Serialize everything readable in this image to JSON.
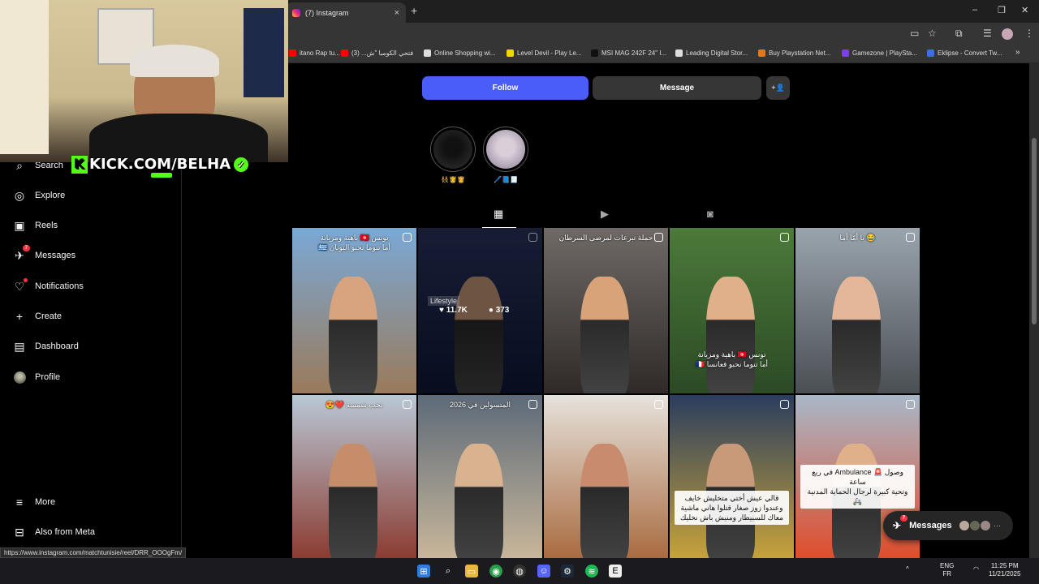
{
  "browser": {
    "tab_title": "(7) Instagram",
    "new_tab": "+",
    "tab_close": "×",
    "window_controls": [
      "–",
      "❐",
      "✕"
    ],
    "bookmarks": [
      {
        "label": "itano Rap tu...",
        "color": "#ff0000"
      },
      {
        "label": "فتحي الكومبا \"ش... (3)",
        "color": "#ff0000"
      },
      {
        "label": "Online Shopping wi...",
        "color": "#dddddd"
      },
      {
        "label": "Level Devil - Play Le...",
        "color": "#f2d600"
      },
      {
        "label": "MSI MAG 242F 24\" I...",
        "color": "#111111"
      },
      {
        "label": "Leading Digital Stor...",
        "color": "#dddddd"
      },
      {
        "label": "Buy Playstation Net...",
        "color": "#e07a1f"
      },
      {
        "label": "Gamezone | PlaySta...",
        "color": "#7b3fe4"
      },
      {
        "label": "Eklipse - Convert Tw...",
        "color": "#3a6df0"
      }
    ],
    "more_bookmarks": "»"
  },
  "sidebar": {
    "items": [
      {
        "label": "Search",
        "icon": "search-icon"
      },
      {
        "label": "Explore",
        "icon": "compass-icon"
      },
      {
        "label": "Reels",
        "icon": "reels-icon"
      },
      {
        "label": "Messages",
        "icon": "messenger-icon",
        "badge": "7"
      },
      {
        "label": "Notifications",
        "icon": "heart-icon"
      },
      {
        "label": "Create",
        "icon": "plus-icon"
      },
      {
        "label": "Dashboard",
        "icon": "dashboard-icon"
      },
      {
        "label": "Profile",
        "icon": "avatar"
      },
      {
        "label": "More",
        "icon": "menu-icon"
      },
      {
        "label": "Also from Meta",
        "icon": "meta-icon"
      }
    ]
  },
  "profile": {
    "follow_label": "Follow",
    "message_label": "Message",
    "add_user_label": "+👤",
    "highlights": [
      {
        "label": "👯‍♀️👸👸",
        "colors": [
          "#111111",
          "#333333"
        ]
      },
      {
        "label": "🖊️📘🧾",
        "colors": [
          "#d8cfd9",
          "#8a7d93"
        ]
      }
    ],
    "tabs": [
      {
        "name": "posts",
        "glyph": "▦"
      },
      {
        "name": "reels",
        "glyph": "▶"
      },
      {
        "name": "tagged",
        "glyph": "◙"
      }
    ]
  },
  "grid": [
    {
      "caption": "تونس 🇹🇳 باهية ومزيانة\nأما تنوما نحبو اليونان 🇬🇷",
      "colors": [
        "#7aa9d6",
        "#9a7a5b"
      ],
      "skin": "#d8a37f"
    },
    {
      "caption": "",
      "colors": [
        "#2a3560",
        "#0e1a3a"
      ],
      "skin": "#c89a7a",
      "hover": true,
      "tag": "Lifestyle",
      "likes": "11.7K",
      "comments": "373"
    },
    {
      "caption": "حملة تبرعات لمرضى السرطان",
      "colors": [
        "#6f6a66",
        "#2f2a28"
      ],
      "skin": "#d9a37a"
    },
    {
      "caption": "تونس 🇹🇳 باهية ومزيانة\nأما تنوما نحبو فعانسا 🇫🇷",
      "colors": [
        "#4c7a3a",
        "#2b4a25"
      ],
      "skin": "#e0b08a"
    },
    {
      "caption": "😂 يا أمّا أما",
      "colors": [
        "#9aa4ad",
        "#4a4f54"
      ],
      "skin": "#e4b69a"
    },
    {
      "caption": "نحب شمسة ❤️😍",
      "colors": [
        "#b9c8d5",
        "#8a3a30"
      ],
      "skin": "#c68d6a"
    },
    {
      "caption": "المتسولين في 2026",
      "colors": [
        "#5d6a78",
        "#c9b79b"
      ],
      "skin": "#d9b28f"
    },
    {
      "caption": "",
      "colors": [
        "#e6e2dc",
        "#a86a3e"
      ],
      "skin": "#c88b6d"
    },
    {
      "caption": "قالي عيش أختي متخليش خايف\nوعندوا زوز صغار قتلوا هاني ماشية\nمعاك للسبيطار ومنيش باش نخليك",
      "colors": [
        "#2a3d5e",
        "#c8a43a"
      ],
      "skin": "#c89a7a",
      "boxed": true
    },
    {
      "caption": "وصول 🚨 Ambulance في ربع ساعة\nوتحية كبيرة لرجال الحماية المدنية 🚑",
      "colors": [
        "#a8b8c8",
        "#e04b2a"
      ],
      "skin": "#e0b08a",
      "boxed": true
    }
  ],
  "messages_pill": {
    "label": "Messages",
    "badge": "7",
    "more": "···"
  },
  "status_url": "https://www.instagram.com/matchtunisie/reel/DRR_OOOgFm/",
  "stream_overlay": {
    "kick": "KICK.COM/BELHA"
  },
  "taskbar": {
    "lang_top": "ENG",
    "lang_bottom": "FR",
    "time": "11:25 PM",
    "date": "11/21/2025"
  }
}
